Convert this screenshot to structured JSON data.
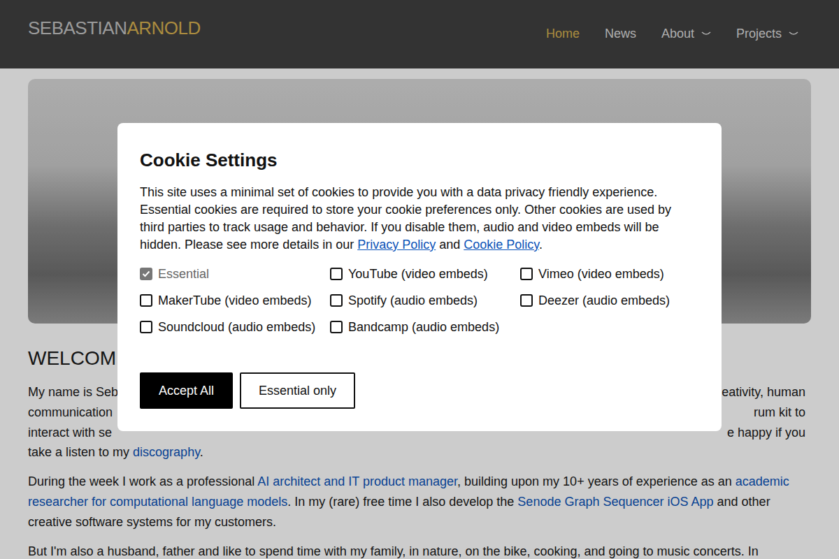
{
  "header": {
    "logo_first": "SEBASTIAN",
    "logo_last": "ARNOLD",
    "nav": [
      {
        "label": "Home",
        "selected": true,
        "has_menu": false
      },
      {
        "label": "News",
        "selected": false,
        "has_menu": false
      },
      {
        "label": "About",
        "selected": false,
        "has_menu": true
      },
      {
        "label": "Projects",
        "selected": false,
        "has_menu": true
      }
    ]
  },
  "page": {
    "heading": "WELCOM",
    "covered_lines": [
      {
        "left": "My name is Seb",
        "right": "eativity, human"
      },
      {
        "left": "communication",
        "right": "rum kit to"
      },
      {
        "left": "interact with se",
        "right": "e happy if you"
      }
    ],
    "paragraphs": [
      [
        {
          "text": "take a listen to my ",
          "kind": "text"
        },
        {
          "text": "discography",
          "kind": "link"
        },
        {
          "text": ".",
          "kind": "text"
        }
      ],
      [
        {
          "text": "During the week I work as a professional ",
          "kind": "text"
        },
        {
          "text": "AI architect and IT product manager",
          "kind": "link"
        },
        {
          "text": ", building upon my 10+ years of experience as an ",
          "kind": "text"
        },
        {
          "text": "academic researcher for computational language models",
          "kind": "link"
        },
        {
          "text": ". In my (rare) free time I also develop the ",
          "kind": "text"
        },
        {
          "text": "Senode Graph Sequencer iOS App",
          "kind": "link"
        },
        {
          "text": " and other creative software systems for my customers.",
          "kind": "text"
        }
      ],
      [
        {
          "text": "But I'm also a husband, father and like to spend time with my family, in nature, on the bike, cooking, and going to music concerts. In",
          "kind": "text"
        }
      ]
    ]
  },
  "cookie_dialog": {
    "title": "Cookie Settings",
    "text": [
      {
        "text": "This site uses a minimal set of cookies to provide you with a data privacy friendly experience. Essential cookies are required to store your cookie preferences only. Other cookies are used by third parties to track usage and behavior. If you disable them, audio and video embeds will be hidden. Please see more details in our ",
        "kind": "text"
      },
      {
        "text": "Privacy Policy",
        "kind": "link"
      },
      {
        "text": " and ",
        "kind": "text"
      },
      {
        "text": "Cookie Policy",
        "kind": "link"
      },
      {
        "text": ".",
        "kind": "text"
      }
    ],
    "options": [
      {
        "label": "Essential",
        "checked": true,
        "disabled": true
      },
      {
        "label": "YouTube (video embeds)",
        "checked": false,
        "disabled": false
      },
      {
        "label": "Vimeo (video embeds)",
        "checked": false,
        "disabled": false
      },
      {
        "label": "MakerTube (video embeds)",
        "checked": false,
        "disabled": false
      },
      {
        "label": "Spotify (audio embeds)",
        "checked": false,
        "disabled": false
      },
      {
        "label": "Deezer (audio embeds)",
        "checked": false,
        "disabled": false
      },
      {
        "label": "Soundcloud (audio embeds)",
        "checked": false,
        "disabled": false
      },
      {
        "label": "Bandcamp (audio embeds)",
        "checked": false,
        "disabled": false
      }
    ],
    "buttons": [
      {
        "label": "Accept All",
        "kind": "primary"
      },
      {
        "label": "Essential only",
        "kind": "secondary"
      }
    ]
  }
}
